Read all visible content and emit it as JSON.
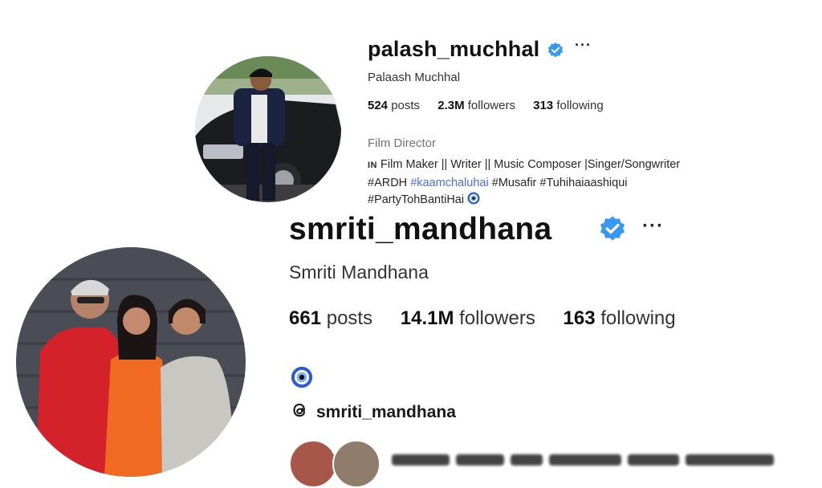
{
  "profiles": [
    {
      "username": "palash_muchhal",
      "display_name": "Palaash Muchhal",
      "stats": {
        "posts": "524",
        "posts_label": "posts",
        "followers": "2.3M",
        "followers_label": "followers",
        "following": "313",
        "following_label": "following"
      },
      "category": "Film Director",
      "bio": {
        "line1_prefix": "IN",
        "line1": "Film Maker || Writer || Music Composer |Singer/Songwriter",
        "line2_a": "#ARDH",
        "line2_link": "#kaamchaluhai",
        "line2_b": "#Musafir #Tuhihaiaashiqui",
        "line3": "#PartyTohBantiHai"
      },
      "more_label": "···",
      "verified_icon": "verified-badge-icon"
    },
    {
      "username": "smriti_mandhana",
      "display_name": "Smriti Mandhana",
      "stats": {
        "posts": "661",
        "posts_label": "posts",
        "followers": "14.1M",
        "followers_label": "followers",
        "following": "163",
        "following_label": "following"
      },
      "threads_handle": "smriti_mandhana",
      "more_label": "···",
      "verified_icon": "verified-badge-icon"
    }
  ],
  "colors": {
    "verified": "#3897f0",
    "link": "#4a6ee8",
    "evil_eye": "#2d5bd8"
  }
}
